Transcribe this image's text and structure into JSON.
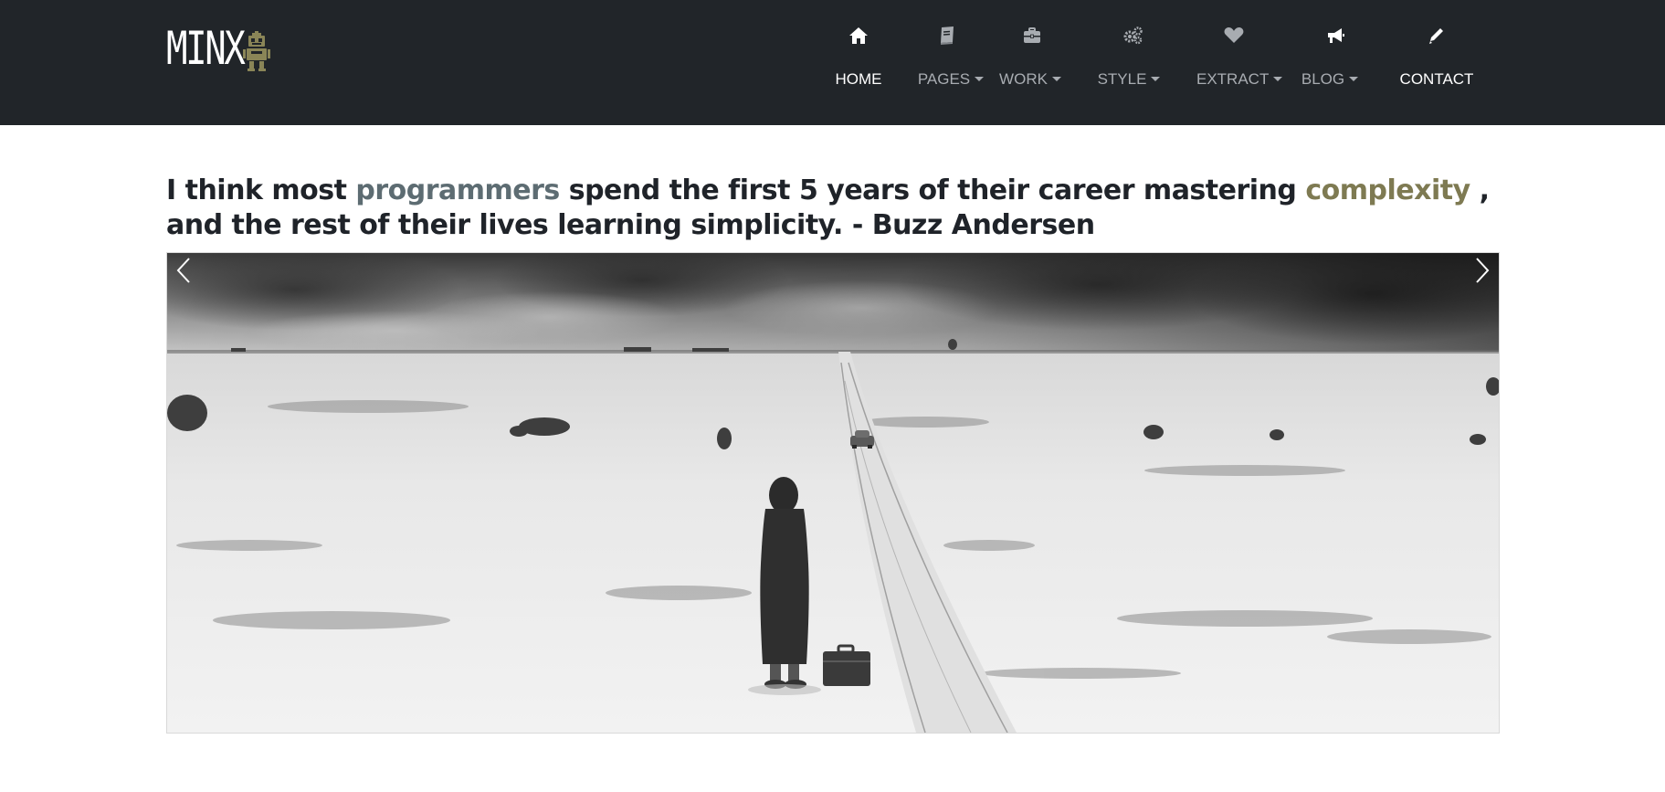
{
  "brand": {
    "name": "MINX"
  },
  "nav": {
    "items": [
      {
        "label": "HOME",
        "icon": "home-icon",
        "dropdown": false,
        "active": true
      },
      {
        "label": "PAGES",
        "icon": "book-icon",
        "dropdown": true,
        "active": false
      },
      {
        "label": "WORK",
        "icon": "briefcase-icon",
        "dropdown": true,
        "active": false
      },
      {
        "label": "STYLE",
        "icon": "gears-icon",
        "dropdown": true,
        "active": false
      },
      {
        "label": "EXTRACT",
        "icon": "heart-icon",
        "dropdown": true,
        "active": false
      },
      {
        "label": "BLOG",
        "icon": "bullhorn-icon",
        "dropdown": true,
        "active": false
      },
      {
        "label": "CONTACT",
        "icon": "pencil-icon",
        "dropdown": false,
        "active": true
      }
    ]
  },
  "quote": {
    "part1": "I think most ",
    "highlight1": "programmers",
    "part2": " spend the first 5 years of their career mastering ",
    "highlight2": "complexity",
    "part3": " , and the rest of their lives learning simplicity. - Buzz Andersen"
  },
  "carousel": {
    "prev_icon": "chevron-left-icon",
    "next_icon": "chevron-right-icon"
  },
  "colors": {
    "navbar_bg": "#212529",
    "nav_text": "#a8acb1",
    "nav_active": "#ffffff",
    "highlight_programmers": "#5d6c72",
    "highlight_complexity": "#7e7a52",
    "logo_robot": "#8a8557"
  }
}
